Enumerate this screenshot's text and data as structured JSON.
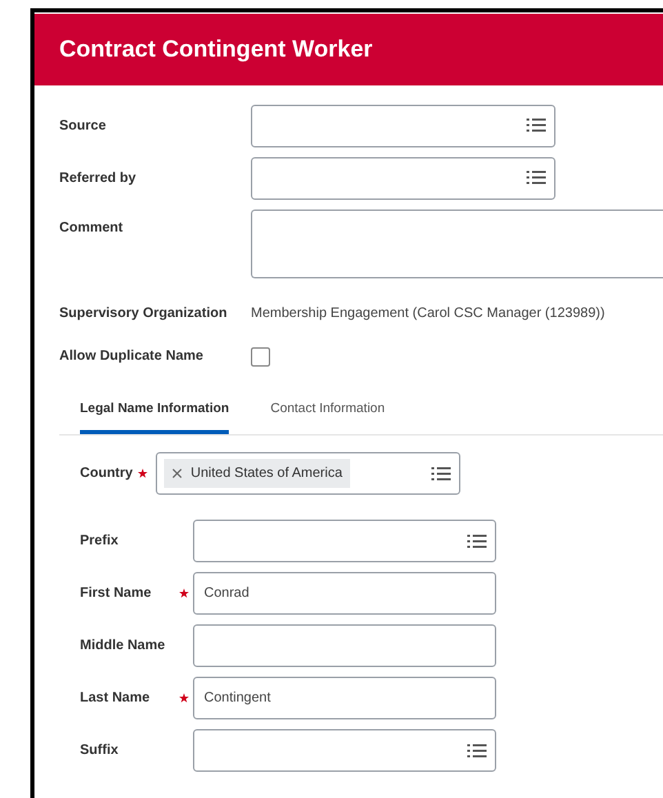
{
  "title": "Contract Contingent Worker",
  "fields": [
    {
      "label": "Source",
      "kind": "select"
    },
    {
      "label": "Referred by",
      "kind": "select"
    },
    {
      "label": "Comment",
      "kind": "textarea"
    },
    {
      "label": "Supervisory Organization",
      "kind": "text",
      "value": "Membership Engagement (Carol CSC Manager (123989))"
    },
    {
      "label": "Allow Duplicate Name",
      "kind": "checkbox",
      "checked": false
    }
  ],
  "tabs": [
    {
      "label": "Legal Name Information",
      "selected": true
    },
    {
      "label": "Contact Information",
      "selected": false
    }
  ],
  "country": {
    "label": "Country",
    "required": true,
    "chip": "United States of America"
  },
  "name_fields": [
    {
      "label": "Prefix",
      "kind": "select",
      "required": false
    },
    {
      "label": "First Name",
      "kind": "text",
      "required": true,
      "value": "Conrad"
    },
    {
      "label": "Middle Name",
      "kind": "text",
      "required": false
    },
    {
      "label": "Last Name",
      "kind": "text",
      "required": true,
      "value": "Contingent"
    },
    {
      "label": "Suffix",
      "kind": "select",
      "required": false
    }
  ]
}
